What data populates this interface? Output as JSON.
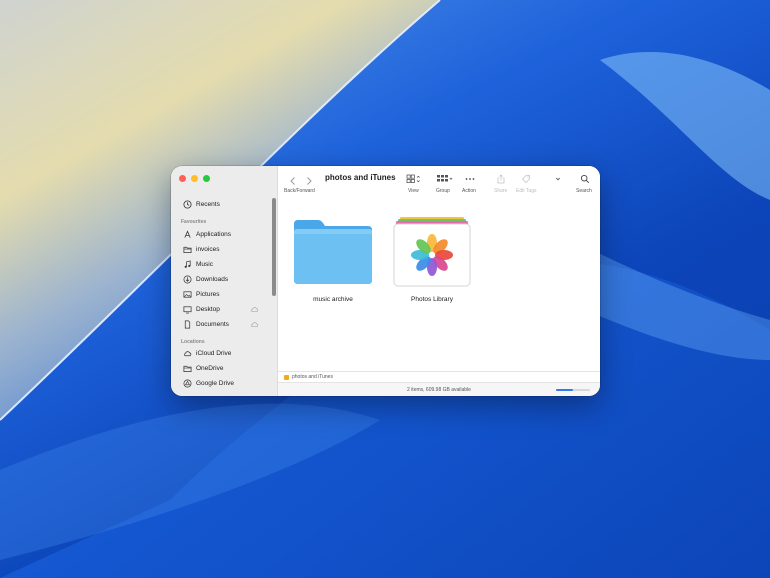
{
  "window": {
    "title": "photos and iTunes"
  },
  "toolbar": {
    "back_forward_label": "Back/Forward",
    "view_label": "View",
    "group_label": "Group",
    "action_label": "Action",
    "share_label": "Share",
    "edit_tags_label": "Edit Tags",
    "search_label": "Search"
  },
  "sidebar": {
    "recents": "Recents",
    "favourites_header": "Favourites",
    "favourites": [
      {
        "label": "Applications",
        "icon": "applications-icon"
      },
      {
        "label": "invoices",
        "icon": "folder-icon"
      },
      {
        "label": "Music",
        "icon": "music-note-icon"
      },
      {
        "label": "Downloads",
        "icon": "download-icon"
      },
      {
        "label": "Pictures",
        "icon": "photo-icon"
      },
      {
        "label": "Desktop",
        "icon": "desktop-icon"
      },
      {
        "label": "Documents",
        "icon": "document-icon"
      }
    ],
    "locations_header": "Locations",
    "locations": [
      {
        "label": "iCloud Drive",
        "icon": "cloud-icon"
      },
      {
        "label": "OneDrive",
        "icon": "folder-icon"
      },
      {
        "label": "Google Drive",
        "icon": "google-drive-icon"
      }
    ]
  },
  "content": {
    "items": [
      {
        "name": "music archive",
        "kind": "folder"
      },
      {
        "name": "Photos Library",
        "kind": "photos-library"
      }
    ]
  },
  "pathbar": {
    "path": "photos and iTunes"
  },
  "statusbar": {
    "status": "2 items, 609.98 GB available",
    "zoom_level": 0.5
  },
  "colors": {
    "accent": "#2f7bf0",
    "folder_blue": "#5ab4ee"
  }
}
